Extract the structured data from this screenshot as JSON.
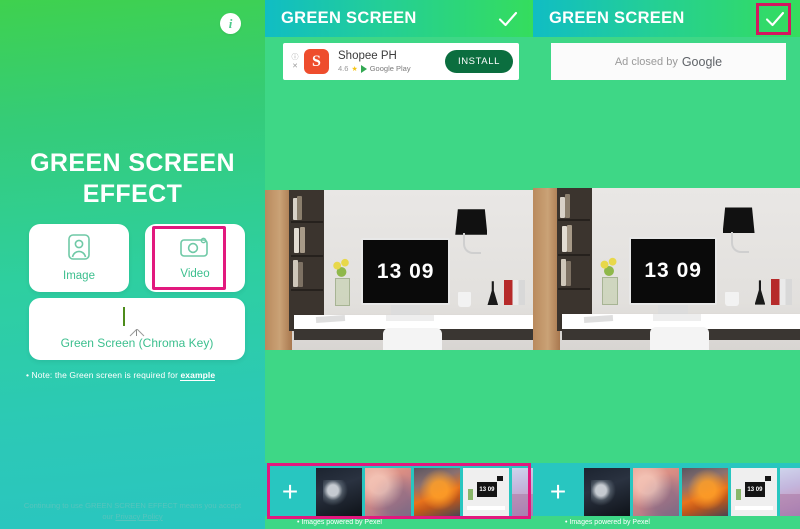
{
  "left_panel": {
    "info_icon_label": "i",
    "app_title_line1": "GREEN SCREEN",
    "app_title_line2": "EFFECT",
    "buttons": [
      {
        "id": "image",
        "label": "Image",
        "icon": "portrait-icon",
        "highlighted": false
      },
      {
        "id": "video",
        "label": "Video",
        "icon": "camera-icon",
        "highlighted": true
      },
      {
        "id": "chroma",
        "label": "Green Screen (Chroma Key)",
        "icon": "green-screen-board-icon",
        "highlighted": false
      }
    ],
    "note_prefix": "• Note: the Green screen is required for ",
    "note_link": "example",
    "footer_line1": "Continuing to use GREEN SCREEN EFFECT means you accept",
    "footer_line2_prefix": "our ",
    "footer_link": "Privacy Policy"
  },
  "phone_middle": {
    "header_title": "GREEN SCREEN",
    "check_icon": "check-icon",
    "checkmark_highlighted": false,
    "ad": {
      "type": "install",
      "info_glyph": "ⓘ",
      "close_glyph": "✕",
      "app_icon_letter": "S",
      "app_name": "Shopee PH",
      "rating": "4.6",
      "star": "★",
      "store": "Google Play",
      "install_label": "INSTALL"
    },
    "photo": {
      "clock_time": "13 09",
      "alt": "desk-with-imac-photo"
    },
    "filmstrip": {
      "add_label": "+",
      "credit": "• Images powered by Pexel",
      "highlighted": true,
      "thumbs": [
        {
          "id": "thumb-dark-smoke",
          "class": "t1"
        },
        {
          "id": "thumb-pink-clouds",
          "class": "t2"
        },
        {
          "id": "thumb-orange-fire-clouds",
          "class": "t3"
        },
        {
          "id": "thumb-desk-imac",
          "class": "t4",
          "mini_time": "13 09"
        },
        {
          "id": "thumb-purple-sky",
          "class": "t5"
        }
      ]
    }
  },
  "phone_right": {
    "header_title": "GREEN SCREEN",
    "check_icon": "check-icon",
    "checkmark_highlighted": true,
    "ad": {
      "type": "closed",
      "closed_text": "Ad closed by",
      "closed_brand": "Google"
    },
    "photo": {
      "clock_time": "13 09",
      "alt": "desk-with-imac-photo"
    },
    "filmstrip": {
      "add_label": "+",
      "credit": "• Images powered by Pexel",
      "highlighted": false,
      "thumbs": [
        {
          "id": "thumb-dark-smoke",
          "class": "t1"
        },
        {
          "id": "thumb-pink-clouds",
          "class": "t2"
        },
        {
          "id": "thumb-orange-fire-clouds",
          "class": "t3"
        },
        {
          "id": "thumb-desk-imac",
          "class": "t4",
          "mini_time": "13 09"
        },
        {
          "id": "thumb-purple-sky",
          "class": "t5"
        }
      ]
    }
  },
  "colors": {
    "highlight_pink": "#e2187e",
    "highlight_pink_dark": "#d4165f",
    "brand_green": "#3ed786",
    "brand_teal": "#28c6c0",
    "accent_text_green": "#3cbf8e",
    "install_green": "#0b6e3f",
    "shopee_orange": "#ee4d2d"
  }
}
